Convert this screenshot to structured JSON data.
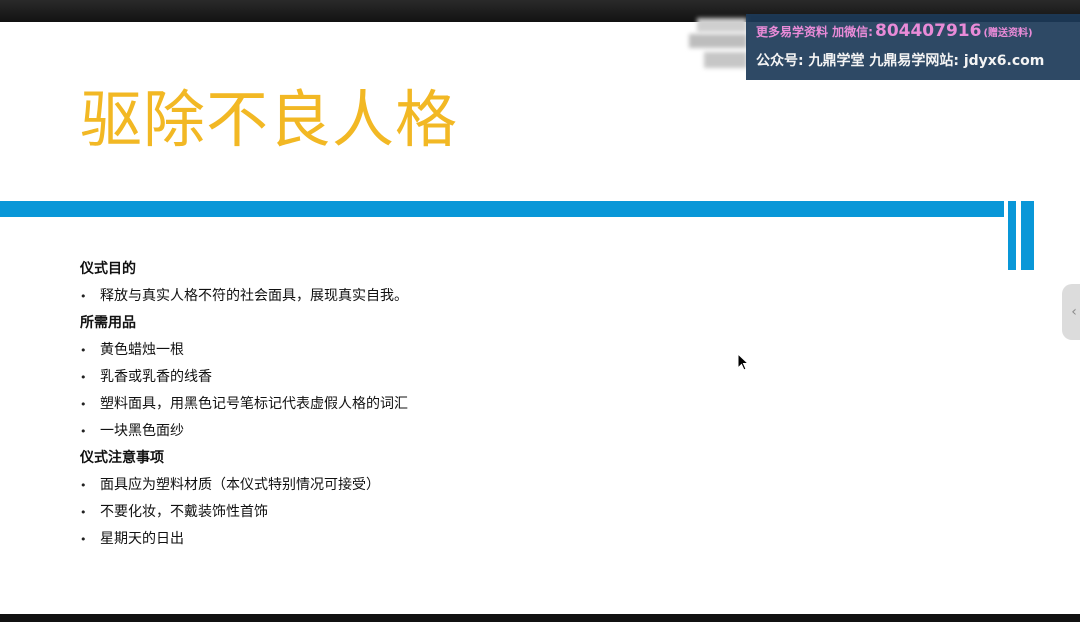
{
  "slide": {
    "title": "驱除不良人格",
    "sections": [
      {
        "heading": "仪式目的",
        "items": [
          "释放与真实人格不符的社会面具，展现真实自我。"
        ]
      },
      {
        "heading": "所需用品",
        "items": [
          "黄色蜡烛一根",
          "乳香或乳香的线香",
          "塑料面具，用黑色记号笔标记代表虚假人格的词汇",
          "一块黑色面纱"
        ]
      },
      {
        "heading": "仪式注意事项",
        "items": [
          "面具应为塑料材质（本仪式特别情况可接受）",
          "不要化妆，不戴装饰性首饰",
          "星期天的日出"
        ]
      }
    ],
    "bullet_symbol": "•"
  },
  "watermark": {
    "line1_lead": "更多易学资料 加微信:",
    "line1_phone": "804407916",
    "line1_gift": "(赠送资料)",
    "line2": "公众号: 九鼎学堂 九鼎易学网站: jdyx6.com"
  },
  "side_tab": {
    "icon": "chevron-left-icon",
    "glyph": "‹"
  },
  "colors": {
    "title": "#f2b824",
    "accent": "#0997d8",
    "watermark_bg": "#1c3a58",
    "watermark_highlight": "#e98bd8"
  }
}
